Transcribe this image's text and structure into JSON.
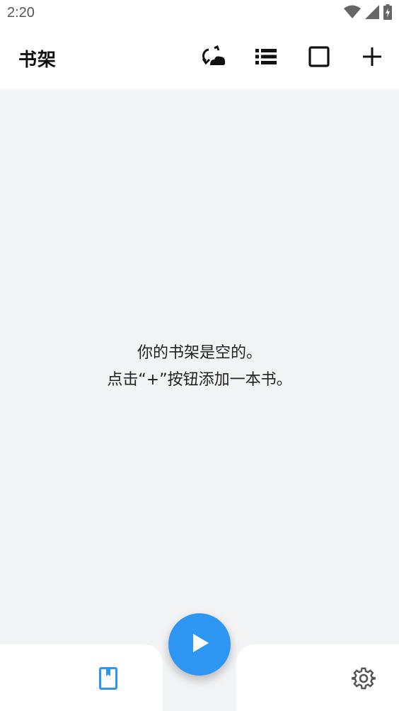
{
  "status_bar": {
    "time": "2:20",
    "icons": [
      "wifi-icon",
      "signal-icon",
      "battery-charging-icon"
    ]
  },
  "app_bar": {
    "title": "书架",
    "actions": [
      {
        "name": "sync-icon"
      },
      {
        "name": "list-view-icon"
      },
      {
        "name": "grid-view-icon"
      },
      {
        "name": "add-icon"
      }
    ]
  },
  "empty_state": {
    "line1": "你的书架是空的。",
    "line2": "点击“+”按钮添加一本书。"
  },
  "fab": {
    "icon": "play-icon",
    "color": "#2d96f3"
  },
  "bottom_nav": {
    "items": [
      {
        "icon": "bookshelf-icon",
        "active": true,
        "color": "#2d96f3"
      },
      {
        "icon": "settings-gear-icon",
        "active": false,
        "color": "#555555"
      }
    ]
  }
}
